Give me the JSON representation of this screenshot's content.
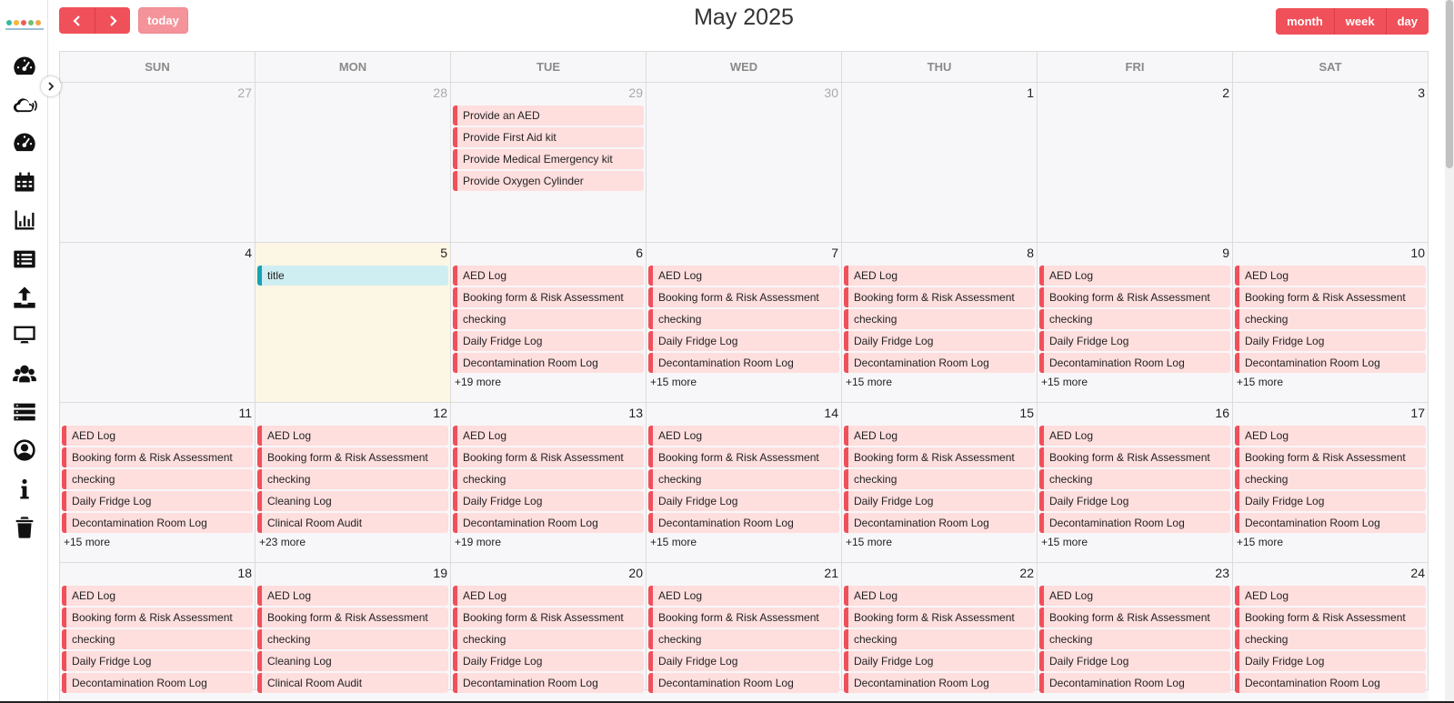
{
  "sidebar": {
    "logo_colors": [
      "#37b6a7",
      "#f7b733",
      "#f05a5a",
      "#6fbf73",
      "#f0a64a"
    ],
    "icons": [
      {
        "name": "dashboard-icon",
        "kind": "gauge"
      },
      {
        "name": "cloud-wifi-icon",
        "kind": "cloud"
      },
      {
        "name": "speedometer-icon",
        "kind": "gauge"
      },
      {
        "name": "calendar-icon",
        "kind": "calendar"
      },
      {
        "name": "bar-chart-icon",
        "kind": "chart"
      },
      {
        "name": "list-icon",
        "kind": "list"
      },
      {
        "name": "upload-icon",
        "kind": "upload"
      },
      {
        "name": "monitor-icon",
        "kind": "monitor"
      },
      {
        "name": "users-icon",
        "kind": "users"
      },
      {
        "name": "server-icon",
        "kind": "server"
      },
      {
        "name": "user-circle-icon",
        "kind": "user"
      },
      {
        "name": "info-icon",
        "kind": "info"
      },
      {
        "name": "trash-icon",
        "kind": "trash"
      }
    ]
  },
  "toolbar": {
    "prev_label": "‹",
    "next_label": "›",
    "today_label": "today",
    "title": "May 2025",
    "views": [
      "month",
      "week",
      "day"
    ]
  },
  "colors": {
    "accent": "#f0505a",
    "event_bg": "#ffdede",
    "today_bg": "#fcf6e4",
    "teal": "#17a2b8"
  },
  "days_of_week": [
    "SUN",
    "MON",
    "TUE",
    "WED",
    "THU",
    "FRI",
    "SAT"
  ],
  "weeks": [
    {
      "days": [
        {
          "num": "27",
          "other": true,
          "events": [],
          "more": ""
        },
        {
          "num": "28",
          "other": true,
          "events": [],
          "more": ""
        },
        {
          "num": "29",
          "other": true,
          "events": [
            "Provide an AED",
            "Provide First Aid kit",
            "Provide Medical Emergency kit",
            "Provide Oxygen Cylinder"
          ],
          "more": ""
        },
        {
          "num": "30",
          "other": true,
          "events": [],
          "more": ""
        },
        {
          "num": "1",
          "events": [],
          "more": ""
        },
        {
          "num": "2",
          "events": [],
          "more": ""
        },
        {
          "num": "3",
          "events": [],
          "more": ""
        }
      ]
    },
    {
      "days": [
        {
          "num": "4",
          "events": [],
          "more": ""
        },
        {
          "num": "5",
          "today": true,
          "events": [
            "title"
          ],
          "teal": true,
          "more": ""
        },
        {
          "num": "6",
          "events": [
            "AED Log",
            "Booking form & Risk Assessment",
            "checking",
            "Daily Fridge Log",
            "Decontamination Room Log"
          ],
          "more": "+19 more"
        },
        {
          "num": "7",
          "events": [
            "AED Log",
            "Booking form & Risk Assessment",
            "checking",
            "Daily Fridge Log",
            "Decontamination Room Log"
          ],
          "more": "+15 more"
        },
        {
          "num": "8",
          "events": [
            "AED Log",
            "Booking form & Risk Assessment",
            "checking",
            "Daily Fridge Log",
            "Decontamination Room Log"
          ],
          "more": "+15 more"
        },
        {
          "num": "9",
          "events": [
            "AED Log",
            "Booking form & Risk Assessment",
            "checking",
            "Daily Fridge Log",
            "Decontamination Room Log"
          ],
          "more": "+15 more"
        },
        {
          "num": "10",
          "events": [
            "AED Log",
            "Booking form & Risk Assessment",
            "checking",
            "Daily Fridge Log",
            "Decontamination Room Log"
          ],
          "more": "+15 more"
        }
      ]
    },
    {
      "days": [
        {
          "num": "11",
          "events": [
            "AED Log",
            "Booking form & Risk Assessment",
            "checking",
            "Daily Fridge Log",
            "Decontamination Room Log"
          ],
          "more": "+15 more"
        },
        {
          "num": "12",
          "events": [
            "AED Log",
            "Booking form & Risk Assessment",
            "checking",
            "Cleaning Log",
            "Clinical Room Audit"
          ],
          "more": "+23 more"
        },
        {
          "num": "13",
          "events": [
            "AED Log",
            "Booking form & Risk Assessment",
            "checking",
            "Daily Fridge Log",
            "Decontamination Room Log"
          ],
          "more": "+19 more"
        },
        {
          "num": "14",
          "events": [
            "AED Log",
            "Booking form & Risk Assessment",
            "checking",
            "Daily Fridge Log",
            "Decontamination Room Log"
          ],
          "more": "+15 more"
        },
        {
          "num": "15",
          "events": [
            "AED Log",
            "Booking form & Risk Assessment",
            "checking",
            "Daily Fridge Log",
            "Decontamination Room Log"
          ],
          "more": "+15 more"
        },
        {
          "num": "16",
          "events": [
            "AED Log",
            "Booking form & Risk Assessment",
            "checking",
            "Daily Fridge Log",
            "Decontamination Room Log"
          ],
          "more": "+15 more"
        },
        {
          "num": "17",
          "events": [
            "AED Log",
            "Booking form & Risk Assessment",
            "checking",
            "Daily Fridge Log",
            "Decontamination Room Log"
          ],
          "more": "+15 more"
        }
      ]
    },
    {
      "days": [
        {
          "num": "18",
          "events": [
            "AED Log",
            "Booking form & Risk Assessment",
            "checking",
            "Daily Fridge Log",
            "Decontamination Room Log"
          ],
          "more": ""
        },
        {
          "num": "19",
          "events": [
            "AED Log",
            "Booking form & Risk Assessment",
            "checking",
            "Cleaning Log",
            "Clinical Room Audit"
          ],
          "more": ""
        },
        {
          "num": "20",
          "events": [
            "AED Log",
            "Booking form & Risk Assessment",
            "checking",
            "Daily Fridge Log",
            "Decontamination Room Log"
          ],
          "more": ""
        },
        {
          "num": "21",
          "events": [
            "AED Log",
            "Booking form & Risk Assessment",
            "checking",
            "Daily Fridge Log",
            "Decontamination Room Log"
          ],
          "more": ""
        },
        {
          "num": "22",
          "events": [
            "AED Log",
            "Booking form & Risk Assessment",
            "checking",
            "Daily Fridge Log",
            "Decontamination Room Log"
          ],
          "more": ""
        },
        {
          "num": "23",
          "events": [
            "AED Log",
            "Booking form & Risk Assessment",
            "checking",
            "Daily Fridge Log",
            "Decontamination Room Log"
          ],
          "more": ""
        },
        {
          "num": "24",
          "events": [
            "AED Log",
            "Booking form & Risk Assessment",
            "checking",
            "Daily Fridge Log",
            "Decontamination Room Log"
          ],
          "more": ""
        }
      ]
    }
  ]
}
